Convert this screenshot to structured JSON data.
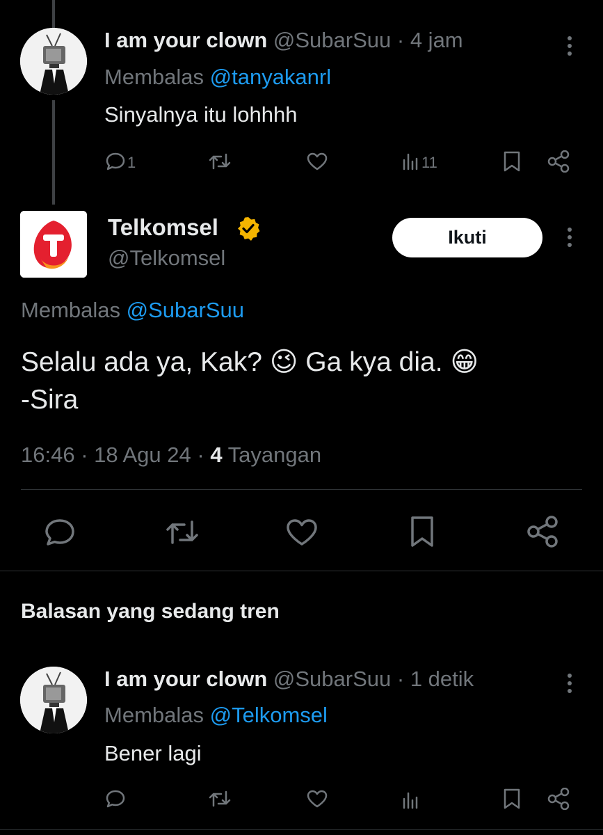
{
  "tweets": [
    {
      "display_name": "I am your clown",
      "handle": "@SubarSuu",
      "time": "· 4 jam",
      "reply_prefix": "Membalas",
      "reply_to": "@tanyakanrl",
      "text": "Sinyalnya itu lohhhh",
      "reply_count": "1",
      "view_count": "11"
    },
    {
      "display_name": "I am your clown",
      "handle": "@SubarSuu",
      "time": "· 1 detik",
      "reply_prefix": "Membalas",
      "reply_to": "@Telkomsel",
      "text": "Bener lagi"
    }
  ],
  "main_tweet": {
    "display_name": "Telkomsel",
    "handle": "@Telkomsel",
    "follow_label": "Ikuti",
    "reply_prefix": "Membalas",
    "reply_to": "@SubarSuu",
    "text_part1": "Selalu ada ya, Kak?",
    "emoji1": "😉",
    "text_part2": "Ga kya dia.",
    "emoji2": "😁",
    "text_line2": "-Sira",
    "timestamp": "16:46 · 18 Agu 24 ·",
    "views_count": "4",
    "views_label": "Tayangan"
  },
  "section_title": "Balasan yang sedang tren",
  "colors": {
    "link": "#1d9bf0",
    "muted": "#71767b",
    "text": "#e7e9ea",
    "badge": "#f4b400",
    "brand": "#e4202f"
  }
}
